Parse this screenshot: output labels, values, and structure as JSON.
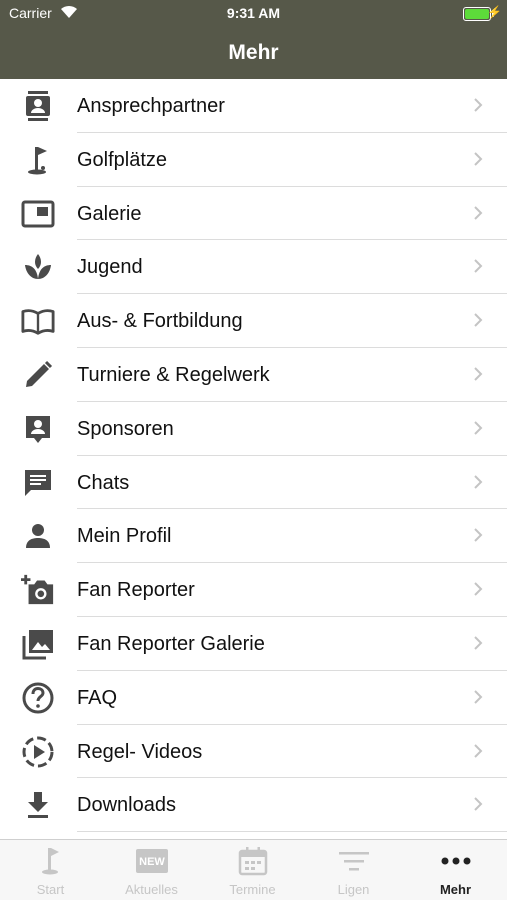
{
  "status": {
    "carrier": "Carrier",
    "time": "9:31 AM",
    "battery_color": "#5ddb3a"
  },
  "nav": {
    "title": "Mehr",
    "bar_color": "#565849"
  },
  "menu": [
    {
      "label": "Ansprechpartner",
      "icon": "contact-card-icon"
    },
    {
      "label": "Golfplätze",
      "icon": "golf-flag-icon"
    },
    {
      "label": "Galerie",
      "icon": "gallery-icon"
    },
    {
      "label": "Jugend",
      "icon": "sprout-icon"
    },
    {
      "label": "Aus- & Fortbildung",
      "icon": "book-icon"
    },
    {
      "label": "Turniere & Regelwerk",
      "icon": "pencil-icon"
    },
    {
      "label": "Sponsoren",
      "icon": "sponsor-badge-icon"
    },
    {
      "label": "Chats",
      "icon": "chat-icon"
    },
    {
      "label": "Mein Profil",
      "icon": "person-icon"
    },
    {
      "label": "Fan Reporter",
      "icon": "add-camera-icon"
    },
    {
      "label": "Fan Reporter Galerie",
      "icon": "photo-library-icon"
    },
    {
      "label": "FAQ",
      "icon": "question-icon"
    },
    {
      "label": "Regel- Videos",
      "icon": "play-circle-icon"
    },
    {
      "label": "Downloads",
      "icon": "download-icon"
    }
  ],
  "tabs": [
    {
      "label": "Start",
      "icon": "golf-flag-icon",
      "active": false
    },
    {
      "label": "Aktuelles",
      "icon": "new-badge-icon",
      "active": false,
      "badge_text": "NEW"
    },
    {
      "label": "Termine",
      "icon": "calendar-icon",
      "active": false
    },
    {
      "label": "Ligen",
      "icon": "filter-lines-icon",
      "active": false
    },
    {
      "label": "Mehr",
      "icon": "more-dots-icon",
      "active": true
    }
  ]
}
